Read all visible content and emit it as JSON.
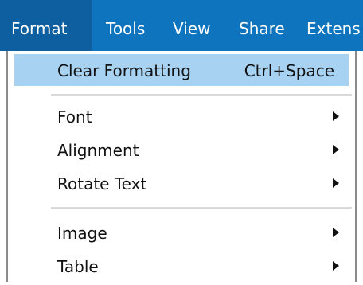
{
  "menubar": {
    "items": [
      {
        "label": "Format"
      },
      {
        "label": "Tools"
      },
      {
        "label": "View"
      },
      {
        "label": "Share"
      },
      {
        "label": "Extens"
      }
    ]
  },
  "format_menu": {
    "clear_formatting": {
      "label": "Clear Formatting",
      "shortcut": "Ctrl+Space"
    },
    "font": {
      "label": "Font"
    },
    "alignment": {
      "label": "Alignment"
    },
    "rotate_text": {
      "label": "Rotate Text"
    },
    "image": {
      "label": "Image"
    },
    "table": {
      "label": "Table"
    }
  },
  "colors": {
    "menubar_bg": "#0e74be",
    "active_menu_bg": "#0d5fa0",
    "highlight_bg": "#a8d2f2"
  }
}
